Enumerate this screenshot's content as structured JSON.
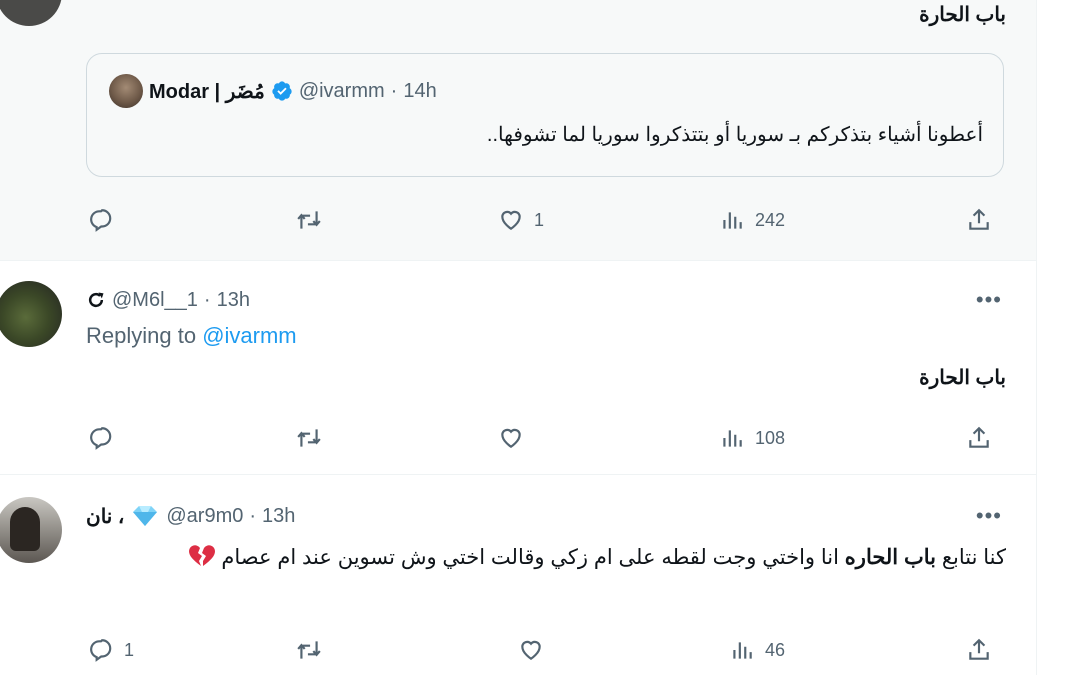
{
  "tweet1": {
    "text": "باب الحارة",
    "quote": {
      "display_name": "Modar | مُضَر",
      "handle": "@ivarmm",
      "time": "14h",
      "text": "أعطونا أشياء بتذكركم بـ سوريا أو بتتذكروا سوريا لما تشوفها.."
    },
    "stats": {
      "replies": "",
      "retweets": "",
      "likes": "1",
      "views": "242"
    }
  },
  "tweet2": {
    "handle": "@M6l__1",
    "time": "13h",
    "replying_prefix": "Replying to",
    "replying_handle": "@ivarmm",
    "text": "باب الحارة",
    "stats": {
      "replies": "",
      "retweets": "",
      "likes": "",
      "views": "108"
    }
  },
  "tweet3": {
    "display_name": "نان ،",
    "handle": "@ar9m0",
    "time": "13h",
    "text_before": "كنا نتابع ",
    "text_bold": "باب الحاره",
    "text_after": " انا واختي وجت لقطه على ام زكي وقالت اختي وش تسوين عند ام عصام",
    "stats": {
      "replies": "1",
      "retweets": "",
      "likes": "",
      "views": "46"
    }
  },
  "separator": "·",
  "more_label": "•••",
  "colors": {
    "accent": "#1d9bf0",
    "muted": "#536471",
    "text": "#0f1419",
    "border": "#cfd9de"
  }
}
